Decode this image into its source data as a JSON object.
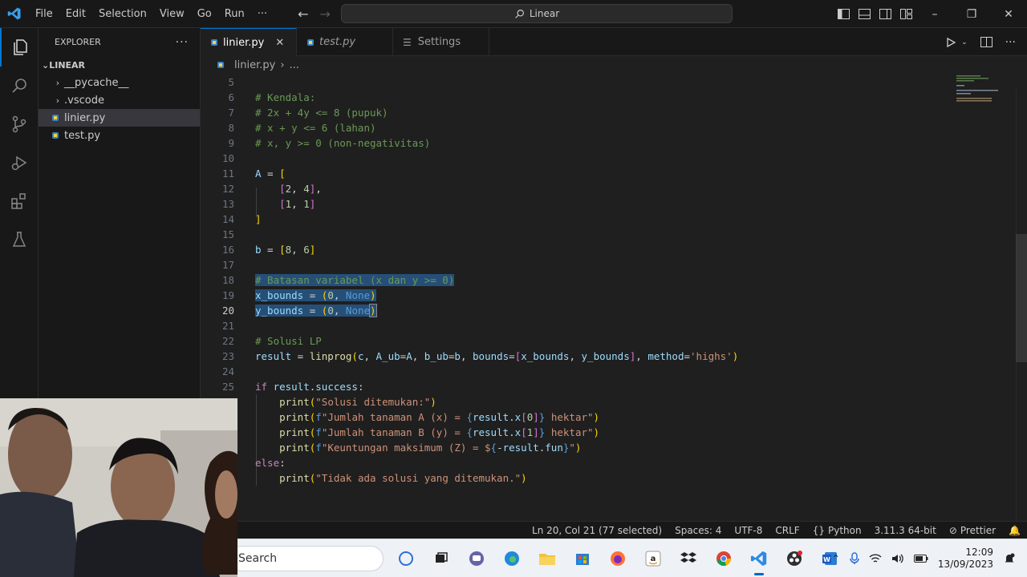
{
  "titlebar": {
    "menu": [
      "File",
      "Edit",
      "Selection",
      "View",
      "Go",
      "Run",
      "···"
    ],
    "search": "Linear"
  },
  "sidebar": {
    "title": "EXPLORER",
    "section": "LINEAR",
    "items": [
      {
        "label": "__pycache__",
        "type": "folder"
      },
      {
        "label": ".vscode",
        "type": "folder"
      },
      {
        "label": "linier.py",
        "type": "file"
      },
      {
        "label": "test.py",
        "type": "file"
      }
    ]
  },
  "tabs": [
    {
      "label": "linier.py",
      "active": true
    },
    {
      "label": "test.py",
      "active": false
    },
    {
      "label": "Settings",
      "active": false
    }
  ],
  "breadcrumb": {
    "file": "linier.py",
    "rest": "..."
  },
  "editor": {
    "line_numbers": [
      "5",
      "6",
      "7",
      "8",
      "9",
      "10",
      "11",
      "12",
      "13",
      "14",
      "15",
      "16",
      "17",
      "18",
      "19",
      "20",
      "21",
      "22",
      "23",
      "24",
      "25",
      "",
      "",
      "",
      "",
      "",
      ""
    ],
    "current_line": "20"
  },
  "statusbar": {
    "position": "Ln 20, Col 21 (77 selected)",
    "spaces": "Spaces: 4",
    "encoding": "UTF-8",
    "eol": "CRLF",
    "language": "Python",
    "interpreter": "3.11.3 64-bit",
    "formatter": "Prettier"
  },
  "taskbar": {
    "search": "Search",
    "time": "12:09",
    "date": "13/09/2023"
  },
  "colors": {
    "accent": "#0078d4",
    "selection": "#264f78"
  }
}
